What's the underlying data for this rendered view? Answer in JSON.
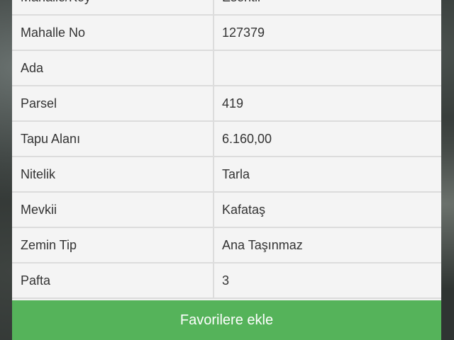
{
  "parcel_info": {
    "rows": [
      {
        "label": "Mahalle/Köy",
        "value": "Esentil"
      },
      {
        "label": "Mahalle No",
        "value": "127379"
      },
      {
        "label": "Ada",
        "value": ""
      },
      {
        "label": "Parsel",
        "value": "419"
      },
      {
        "label": "Tapu Alanı",
        "value": "6.160,00"
      },
      {
        "label": "Nitelik",
        "value": "Tarla"
      },
      {
        "label": "Mevkii",
        "value": "Kafataş"
      },
      {
        "label": "Zemin Tip",
        "value": "Ana Taşınmaz"
      },
      {
        "label": "Pafta",
        "value": "3"
      }
    ]
  },
  "actions": {
    "favorite_label": "Favorilere ekle"
  },
  "colors": {
    "button_bg": "#55b35a",
    "panel_bg": "#f2f2f2",
    "divider": "#dcdcdc"
  }
}
